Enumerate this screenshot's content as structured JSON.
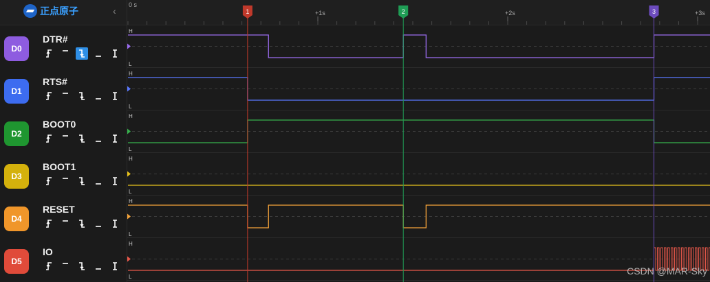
{
  "app": {
    "logo_text": "正点原子",
    "collapse_glyph": "‹"
  },
  "timeline": {
    "start_label": "0 s",
    "ticks": [
      {
        "label": "+1s",
        "time": 1.0
      },
      {
        "label": "+2s",
        "time": 2.0
      },
      {
        "label": "+3s",
        "time": 3.0
      }
    ],
    "markers": [
      {
        "label": "1",
        "time": 0.63,
        "color": "#c0392b"
      },
      {
        "label": "2",
        "time": 1.45,
        "color": "#1f9d55"
      },
      {
        "label": "3",
        "time": 2.77,
        "color": "#6c4bbd"
      }
    ]
  },
  "level_labels": {
    "high": "H",
    "low": "L"
  },
  "channels": [
    {
      "id": "D0",
      "name": "DTR#",
      "color": "#8e5ce0",
      "wave_color": "#9b6cf0",
      "selected_trigger": 2,
      "edges": [
        {
          "t": 0,
          "v": 1
        },
        {
          "t": 0.74,
          "v": 0
        },
        {
          "t": 1.45,
          "v": 1
        },
        {
          "t": 1.57,
          "v": 0
        },
        {
          "t": 2.77,
          "v": 1
        }
      ]
    },
    {
      "id": "D1",
      "name": "RTS#",
      "color": "#3d6cf0",
      "wave_color": "#5a78ff",
      "selected_trigger": -1,
      "edges": [
        {
          "t": 0,
          "v": 1
        },
        {
          "t": 0.63,
          "v": 0
        },
        {
          "t": 2.77,
          "v": 1
        }
      ]
    },
    {
      "id": "D2",
      "name": "BOOT0",
      "color": "#1f9630",
      "wave_color": "#37b24d",
      "selected_trigger": -1,
      "edges": [
        {
          "t": 0,
          "v": 0
        },
        {
          "t": 0.63,
          "v": 1
        },
        {
          "t": 2.77,
          "v": 0
        }
      ]
    },
    {
      "id": "D3",
      "name": "BOOT1",
      "color": "#d4b10c",
      "wave_color": "#e8c21c",
      "selected_trigger": -1,
      "edges": [
        {
          "t": 0,
          "v": 0
        }
      ]
    },
    {
      "id": "D4",
      "name": "RESET",
      "color": "#f0962a",
      "wave_color": "#f5a33a",
      "selected_trigger": -1,
      "edges": [
        {
          "t": 0,
          "v": 1
        },
        {
          "t": 0.63,
          "v": 0
        },
        {
          "t": 0.74,
          "v": 1
        },
        {
          "t": 1.45,
          "v": 0
        },
        {
          "t": 1.57,
          "v": 1
        }
      ]
    },
    {
      "id": "D5",
      "name": "IO",
      "color": "#e04b3a",
      "wave_color": "#e8584a",
      "selected_trigger": -1,
      "edges": [
        {
          "t": 0,
          "v": 0
        }
      ],
      "burst_start": 2.77
    }
  ],
  "watermark": "CSDN @MAR-Sky"
}
